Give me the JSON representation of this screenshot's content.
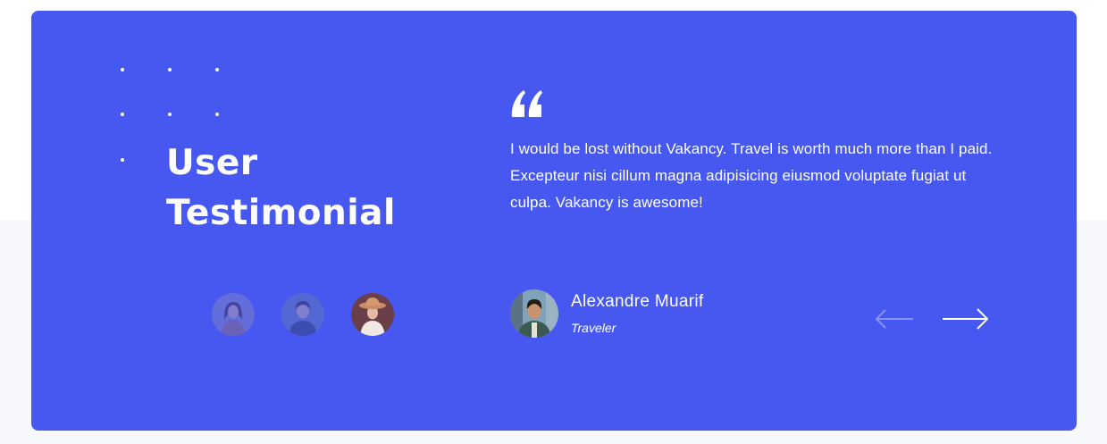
{
  "section": {
    "title_line1": "User",
    "title_line2": "Testimonial"
  },
  "testimonial": {
    "quote": "I would be lost without Vakancy. Travel is worth much more than I paid.  Excepteur nisi cillum magna adipisicing eiusmod voluptate fugiat ut culpa. Vakancy is awesome!",
    "author_name": "Alexandre Muarif",
    "author_role": "Traveler"
  },
  "avatars": [
    {
      "icon": "woman-portrait",
      "active": false
    },
    {
      "icon": "man-portrait",
      "active": false
    },
    {
      "icon": "woman-hat-portrait",
      "active": true
    }
  ],
  "navigation": {
    "prev_icon": "arrow-left-icon",
    "next_icon": "arrow-right-icon"
  },
  "colors": {
    "card_background": "#4658ef",
    "page_top": "#ffffff",
    "page_bottom": "#f7f8fc",
    "text": "#ffffff"
  }
}
